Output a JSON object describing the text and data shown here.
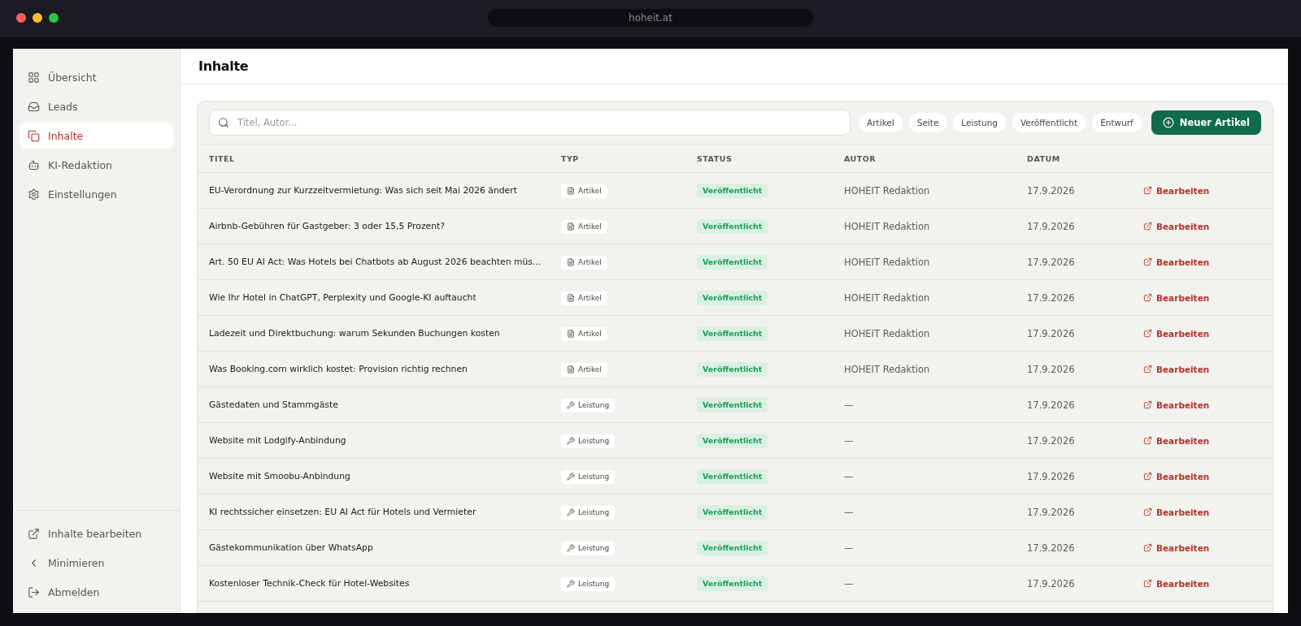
{
  "browser": {
    "address": "hoheit.at"
  },
  "sidebar": {
    "items": [
      {
        "label": "Übersicht",
        "selected": false
      },
      {
        "label": "Leads",
        "selected": false
      },
      {
        "label": "Inhalte",
        "selected": true
      },
      {
        "label": "KI-Redaktion",
        "selected": false
      },
      {
        "label": "Einstellungen",
        "selected": false
      }
    ],
    "footer": [
      {
        "label": "Inhalte bearbeiten"
      },
      {
        "label": "Minimieren"
      },
      {
        "label": "Abmelden"
      }
    ]
  },
  "page": {
    "title": "Inhalte"
  },
  "search": {
    "placeholder": "Titel, Autor..."
  },
  "filters": [
    {
      "label": "Artikel",
      "selected": false
    },
    {
      "label": "Seite",
      "selected": false
    },
    {
      "label": "Leistung",
      "selected": false
    },
    {
      "label": "Veröffentlicht",
      "selected": false
    },
    {
      "label": "Entwurf",
      "selected": false
    }
  ],
  "new_button": "Neuer Artikel",
  "table": {
    "columns": [
      "TITEL",
      "TYP",
      "STATUS",
      "AUTOR",
      "DATUM"
    ],
    "rows": [
      {
        "title": "EU-Verordnung zur Kurzzeitvermietung: Was sich seit Mai 2026 ändert",
        "type": {
          "kind": "article",
          "label": "Artikel"
        },
        "status": "Veröffentlicht",
        "author": "HOHEIT Redaktion",
        "date": "17.9.2026",
        "action": "Bearbeiten"
      },
      {
        "title": "Airbnb-Gebühren für Gastgeber: 3 oder 15,5 Prozent?",
        "type": {
          "kind": "article",
          "label": "Artikel"
        },
        "status": "Veröffentlicht",
        "author": "HOHEIT Redaktion",
        "date": "17.9.2026",
        "action": "Bearbeiten"
      },
      {
        "title": "Art. 50 EU AI Act: Was Hotels bei Chatbots ab August 2026 beachten müs…",
        "type": {
          "kind": "article",
          "label": "Artikel"
        },
        "status": "Veröffentlicht",
        "author": "HOHEIT Redaktion",
        "date": "17.9.2026",
        "action": "Bearbeiten"
      },
      {
        "title": "Wie Ihr Hotel in ChatGPT, Perplexity und Google-KI auftaucht",
        "type": {
          "kind": "article",
          "label": "Artikel"
        },
        "status": "Veröffentlicht",
        "author": "HOHEIT Redaktion",
        "date": "17.9.2026",
        "action": "Bearbeiten"
      },
      {
        "title": "Ladezeit und Direktbuchung: warum Sekunden Buchungen kosten",
        "type": {
          "kind": "article",
          "label": "Artikel"
        },
        "status": "Veröffentlicht",
        "author": "HOHEIT Redaktion",
        "date": "17.9.2026",
        "action": "Bearbeiten"
      },
      {
        "title": "Was Booking.com wirklich kostet: Provision richtig rechnen",
        "type": {
          "kind": "article",
          "label": "Artikel"
        },
        "status": "Veröffentlicht",
        "author": "HOHEIT Redaktion",
        "date": "17.9.2026",
        "action": "Bearbeiten"
      },
      {
        "title": "Gästedaten und Stammgäste",
        "type": {
          "kind": "service",
          "label": "Leistung"
        },
        "status": "Veröffentlicht",
        "author": "—",
        "date": "17.9.2026",
        "action": "Bearbeiten"
      },
      {
        "title": "Website mit Lodgify-Anbindung",
        "type": {
          "kind": "service",
          "label": "Leistung"
        },
        "status": "Veröffentlicht",
        "author": "—",
        "date": "17.9.2026",
        "action": "Bearbeiten"
      },
      {
        "title": "Website mit Smoobu-Anbindung",
        "type": {
          "kind": "service",
          "label": "Leistung"
        },
        "status": "Veröffentlicht",
        "author": "—",
        "date": "17.9.2026",
        "action": "Bearbeiten"
      },
      {
        "title": "KI rechtssicher einsetzen: EU AI Act für Hotels und Vermieter",
        "type": {
          "kind": "service",
          "label": "Leistung"
        },
        "status": "Veröffentlicht",
        "author": "—",
        "date": "17.9.2026",
        "action": "Bearbeiten"
      },
      {
        "title": "Gästekommunikation über WhatsApp",
        "type": {
          "kind": "service",
          "label": "Leistung"
        },
        "status": "Veröffentlicht",
        "author": "—",
        "date": "17.9.2026",
        "action": "Bearbeiten"
      },
      {
        "title": "Kostenloser Technik-Check für Hotel-Websites",
        "type": {
          "kind": "service",
          "label": "Leistung"
        },
        "status": "Veröffentlicht",
        "author": "—",
        "date": "17.9.2026",
        "action": "Bearbeiten"
      }
    ]
  }
}
